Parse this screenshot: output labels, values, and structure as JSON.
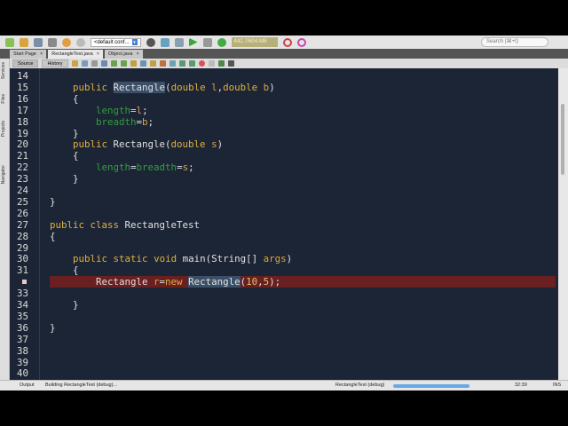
{
  "toolbar": {
    "config": "<default conf...",
    "memory": "442.7/604.MB",
    "search_placeholder": "Search (⌘+I)"
  },
  "tabs": [
    {
      "label": "Start Page"
    },
    {
      "label": "RectangleTest.java"
    },
    {
      "label": "Object.java"
    }
  ],
  "editor_tabs": {
    "source": "Source",
    "history": "History"
  },
  "side_tabs": [
    "Services",
    "Files",
    "Projects",
    "Navigator"
  ],
  "code_lines": [
    {
      "n": "14",
      "tokens": []
    },
    {
      "n": "15",
      "tokens": [
        {
          "t": "    "
        },
        {
          "t": "public",
          "c": "kw"
        },
        {
          "t": " "
        },
        {
          "t": "Rectangle",
          "c": "sel"
        },
        {
          "t": "("
        },
        {
          "t": "double",
          "c": "kw"
        },
        {
          "t": " "
        },
        {
          "t": "l",
          "c": "prm"
        },
        {
          "t": ","
        },
        {
          "t": "double",
          "c": "kw"
        },
        {
          "t": " "
        },
        {
          "t": "b",
          "c": "prm"
        },
        {
          "t": ")"
        }
      ]
    },
    {
      "n": "16",
      "tokens": [
        {
          "t": "    {"
        }
      ]
    },
    {
      "n": "17",
      "tokens": [
        {
          "t": "        "
        },
        {
          "t": "length",
          "c": "fld"
        },
        {
          "t": "="
        },
        {
          "t": "l",
          "c": "prm"
        },
        {
          "t": ";"
        }
      ]
    },
    {
      "n": "18",
      "tokens": [
        {
          "t": "        "
        },
        {
          "t": "breadth",
          "c": "fld"
        },
        {
          "t": "="
        },
        {
          "t": "b",
          "c": "prm"
        },
        {
          "t": ";"
        }
      ]
    },
    {
      "n": "19",
      "tokens": [
        {
          "t": "    }"
        }
      ]
    },
    {
      "n": "20",
      "tokens": [
        {
          "t": "    "
        },
        {
          "t": "public",
          "c": "kw"
        },
        {
          "t": " Rectangle("
        },
        {
          "t": "double",
          "c": "kw"
        },
        {
          "t": " "
        },
        {
          "t": "s",
          "c": "prm"
        },
        {
          "t": ")"
        }
      ]
    },
    {
      "n": "21",
      "tokens": [
        {
          "t": "    {"
        }
      ]
    },
    {
      "n": "22",
      "tokens": [
        {
          "t": "        "
        },
        {
          "t": "length",
          "c": "fld"
        },
        {
          "t": "="
        },
        {
          "t": "breadth",
          "c": "fld"
        },
        {
          "t": "="
        },
        {
          "t": "s",
          "c": "prm"
        },
        {
          "t": ";"
        }
      ]
    },
    {
      "n": "23",
      "tokens": [
        {
          "t": "    }"
        }
      ]
    },
    {
      "n": "24",
      "tokens": []
    },
    {
      "n": "25",
      "tokens": [
        {
          "t": "}"
        }
      ]
    },
    {
      "n": "26",
      "tokens": []
    },
    {
      "n": "27",
      "tokens": [
        {
          "t": "public",
          "c": "kw"
        },
        {
          "t": " "
        },
        {
          "t": "class",
          "c": "kw"
        },
        {
          "t": " RectangleTest"
        }
      ]
    },
    {
      "n": "28",
      "tokens": [
        {
          "t": "{"
        }
      ]
    },
    {
      "n": "29",
      "tokens": []
    },
    {
      "n": "30",
      "tokens": [
        {
          "t": "    "
        },
        {
          "t": "public",
          "c": "kw"
        },
        {
          "t": " "
        },
        {
          "t": "static",
          "c": "kw"
        },
        {
          "t": " "
        },
        {
          "t": "void",
          "c": "kw"
        },
        {
          "t": " main(String[] "
        },
        {
          "t": "args",
          "c": "prm"
        },
        {
          "t": ")"
        }
      ]
    },
    {
      "n": "31",
      "tokens": [
        {
          "t": "    {"
        }
      ]
    },
    {
      "n": "",
      "breakpoint": true,
      "tokens": [
        {
          "t": "        Rectangle "
        },
        {
          "t": "r",
          "c": "prm"
        },
        {
          "t": "="
        },
        {
          "t": "new",
          "c": "kw"
        },
        {
          "t": " "
        },
        {
          "t": "Rectangle",
          "c": "sel"
        },
        {
          "t": "("
        },
        {
          "t": "10",
          "c": "num"
        },
        {
          "t": ","
        },
        {
          "t": "5",
          "c": "num"
        },
        {
          "t": ")"
        },
        {
          "t": ";"
        }
      ]
    },
    {
      "n": "33",
      "tokens": []
    },
    {
      "n": "34",
      "tokens": [
        {
          "t": "    }"
        }
      ]
    },
    {
      "n": "35",
      "tokens": []
    },
    {
      "n": "36",
      "tokens": [
        {
          "t": "}"
        }
      ]
    },
    {
      "n": "37",
      "tokens": []
    },
    {
      "n": "38",
      "tokens": []
    },
    {
      "n": "39",
      "tokens": []
    },
    {
      "n": "40",
      "tokens": []
    }
  ],
  "status": {
    "output_tab": "Output",
    "building": "Building RectangleTest (debug)...",
    "task": "RectangleTest (debug)",
    "progress": 0.9,
    "position": "32:39",
    "mode": "INS"
  }
}
